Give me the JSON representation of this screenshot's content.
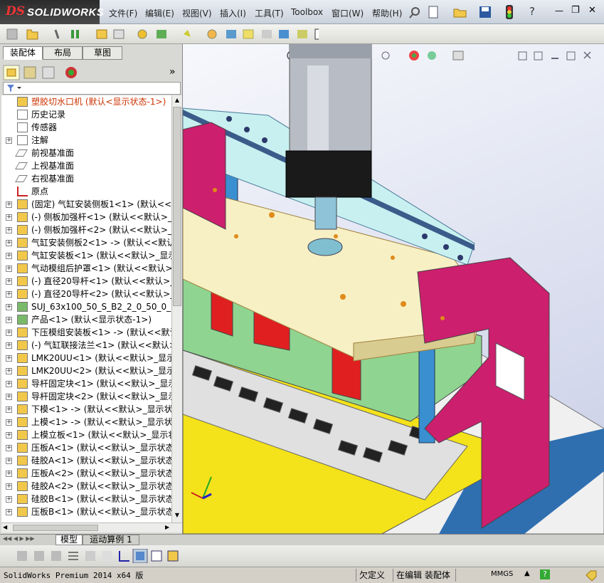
{
  "app": {
    "logo_ds": "DS",
    "logo_name": "SOLIDWORKS"
  },
  "menu": [
    "文件(F)",
    "编辑(E)",
    "视图(V)",
    "插入(I)",
    "工具(T)",
    "Toolbox",
    "窗口(W)",
    "帮助(H)"
  ],
  "window_controls": {
    "help": "?",
    "minimize": "—",
    "restore": "❐",
    "close": "✕"
  },
  "left_tabs": [
    "装配体",
    "布局",
    "草图"
  ],
  "panel_expand": "»",
  "filter_icon": "filter-icon",
  "tree": [
    {
      "expand": "",
      "icon": "assembly-warning",
      "label": "塑胶切水口机  (默认<显示状态-1>)",
      "color": "#cc3300"
    },
    {
      "expand": "",
      "icon": "history",
      "label": "历史记录"
    },
    {
      "expand": "",
      "icon": "sensor",
      "label": "传感器"
    },
    {
      "expand": "+",
      "icon": "annotation",
      "label": "注解"
    },
    {
      "expand": "",
      "icon": "plane",
      "label": "前视基准面"
    },
    {
      "expand": "",
      "icon": "plane",
      "label": "上视基准面"
    },
    {
      "expand": "",
      "icon": "plane",
      "label": "右视基准面"
    },
    {
      "expand": "",
      "icon": "origin",
      "label": "原点"
    },
    {
      "expand": "+",
      "icon": "part",
      "label": "(固定) 气缸安装侧板1<1> (默认<<默"
    },
    {
      "expand": "+",
      "icon": "part",
      "label": "(-) 侧板加强杆<1> (默认<<默认>_显"
    },
    {
      "expand": "+",
      "icon": "part",
      "label": "(-) 侧板加强杆<2> (默认<<默认>_显"
    },
    {
      "expand": "+",
      "icon": "part",
      "label": "气缸安装侧板2<1> -> (默认<<默认>_"
    },
    {
      "expand": "+",
      "icon": "part",
      "label": "气缸安装板<1> (默认<<默认>_显示状"
    },
    {
      "expand": "+",
      "icon": "part",
      "label": "气动模组后护罩<1> (默认<<默认>_显"
    },
    {
      "expand": "+",
      "icon": "part",
      "label": "(-) 直径20导杆<1> (默认<<默认>_显"
    },
    {
      "expand": "+",
      "icon": "part",
      "label": "(-) 直径20导杆<2> (默认<<默认>_显"
    },
    {
      "expand": "+",
      "icon": "subassembly",
      "label": "SUJ_63x100_50_S_B2_2_0_50_0_<1> ("
    },
    {
      "expand": "+",
      "icon": "subassembly",
      "label": "产品<1> (默认<显示状态-1>)"
    },
    {
      "expand": "+",
      "icon": "part",
      "label": "下压模组安装板<1> -> (默认<<默认>_"
    },
    {
      "expand": "+",
      "icon": "part",
      "label": "(-) 气缸联接法兰<1> (默认<<默认>_"
    },
    {
      "expand": "+",
      "icon": "part",
      "label": "LMK20UU<1> (默认<<默认>_显示状态"
    },
    {
      "expand": "+",
      "icon": "part",
      "label": "LMK20UU<2> (默认<<默认>_显示状态"
    },
    {
      "expand": "+",
      "icon": "part",
      "label": "导杆固定块<1> (默认<<默认>_显示状"
    },
    {
      "expand": "+",
      "icon": "part",
      "label": "导杆固定块<2> (默认<<默认>_显示状"
    },
    {
      "expand": "+",
      "icon": "part",
      "label": "下模<1> -> (默认<<默认>_显示状态"
    },
    {
      "expand": "+",
      "icon": "part",
      "label": "上模<1> -> (默认<<默认>_显示状态"
    },
    {
      "expand": "+",
      "icon": "part",
      "label": "上模立板<1> (默认<<默认>_显示状态"
    },
    {
      "expand": "+",
      "icon": "part",
      "label": "压板A<1> (默认<<默认>_显示状态 1>"
    },
    {
      "expand": "+",
      "icon": "part",
      "label": "硅胶A<1> (默认<<默认>_显示状态 1>"
    },
    {
      "expand": "+",
      "icon": "part",
      "label": "压板A<2> (默认<<默认>_显示状态 1>"
    },
    {
      "expand": "+",
      "icon": "part",
      "label": "硅胶A<2> (默认<<默认>_显示状态 1>"
    },
    {
      "expand": "+",
      "icon": "part",
      "label": "硅胶B<1> (默认<<默认>_显示状态 1>"
    },
    {
      "expand": "+",
      "icon": "part",
      "label": "压板B<1> (默认<<默认>_显示状态 1>"
    }
  ],
  "bottom_tabs": [
    "模型",
    "运动算例 1"
  ],
  "status": {
    "product": "SolidWorks Premium 2014 x64 版",
    "undefined": "欠定义",
    "editing": "在编辑 装配体",
    "units": "MMGS",
    "help": "?"
  },
  "colors": {
    "accent_red": "#cc2222",
    "magenta": "#cc1f6e",
    "yellow": "#f4e21a",
    "green": "#8fd490",
    "cream": "#f7f0c4",
    "cyan": "#c8f0f0"
  }
}
